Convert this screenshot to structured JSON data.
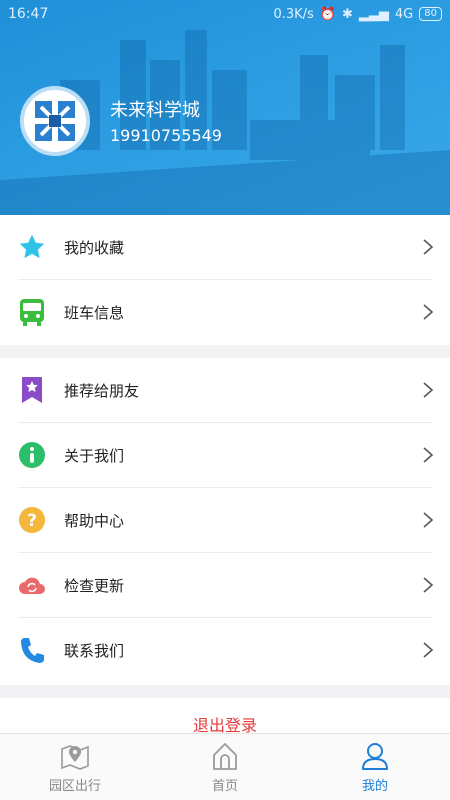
{
  "status_bar": {
    "time": "16:47",
    "speed": "0.3K/s",
    "network": "4G",
    "battery": "80"
  },
  "profile": {
    "name": "未来科学城",
    "phone": "19910755549"
  },
  "menu_group_1": [
    {
      "label": "我的收藏",
      "icon": "star-icon",
      "color": "#2fc3e8"
    },
    {
      "label": "班车信息",
      "icon": "bus-icon",
      "color": "#3cbc3c"
    }
  ],
  "menu_group_2": [
    {
      "label": "推荐给朋友",
      "icon": "bookmark-star-icon",
      "color": "#8a4bc7"
    },
    {
      "label": "关于我们",
      "icon": "info-icon",
      "color": "#2bbf6b"
    },
    {
      "label": "帮助中心",
      "icon": "question-icon",
      "color": "#f4b63b"
    },
    {
      "label": "检查更新",
      "icon": "cloud-refresh-icon",
      "color": "#e96a6a"
    },
    {
      "label": "联系我们",
      "icon": "phone-icon",
      "color": "#2489e0"
    }
  ],
  "logout": {
    "label": "退出登录",
    "color": "#e63b3b"
  },
  "bottom_nav": [
    {
      "label": "园区出行",
      "icon": "map-pin-icon"
    },
    {
      "label": "首页",
      "icon": "home-icon"
    },
    {
      "label": "我的",
      "icon": "user-icon",
      "active": true
    }
  ],
  "colors": {
    "accent": "#1e7fd6",
    "header": "#2a9be0"
  }
}
